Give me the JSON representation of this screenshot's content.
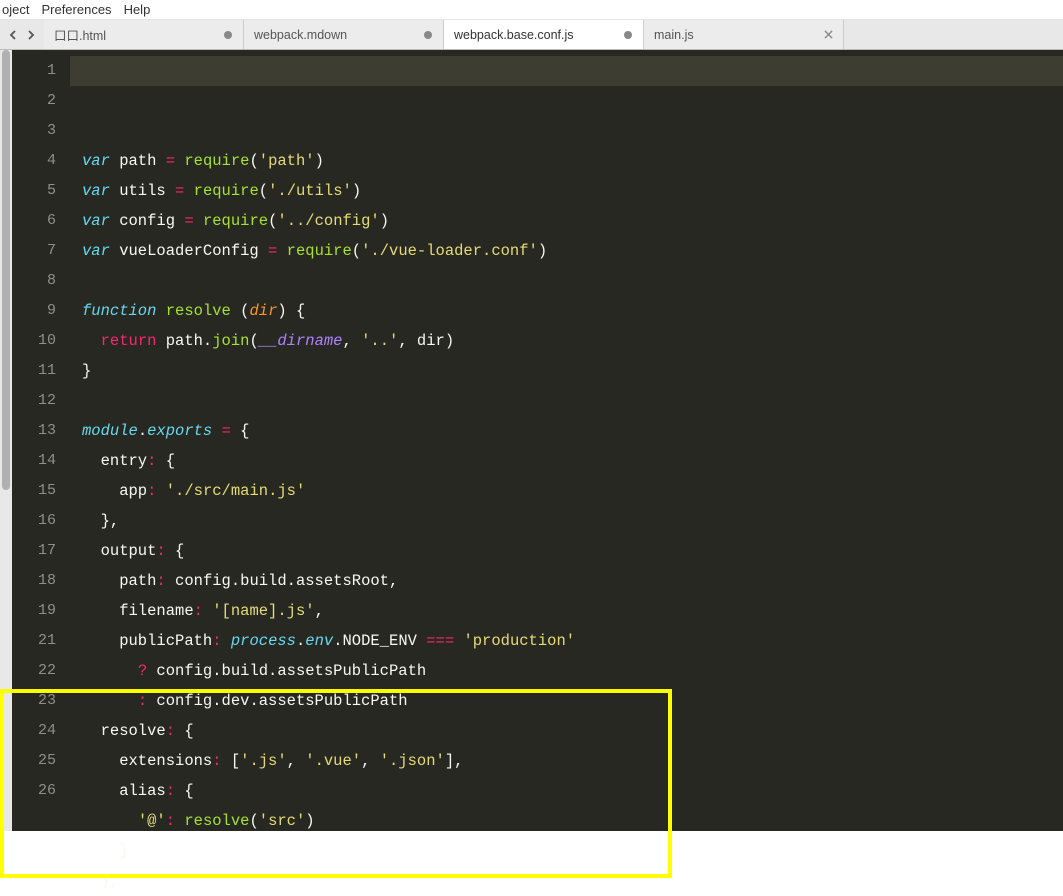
{
  "menu": {
    "project": "oject",
    "preferences": "Preferences",
    "help": "Help"
  },
  "tabs": [
    {
      "label": "口口.html",
      "dirty": true,
      "active": false
    },
    {
      "label": "webpack.mdown",
      "dirty": true,
      "active": false
    },
    {
      "label": "webpack.base.conf.js",
      "dirty": true,
      "active": true
    },
    {
      "label": "main.js",
      "dirty": false,
      "active": false
    }
  ],
  "gutter_start": 1,
  "gutter_end": 26,
  "code_tokens": [
    [
      [
        "kw-italic",
        "var"
      ],
      [
        "plain",
        " path "
      ],
      [
        "kw-red",
        "="
      ],
      [
        "plain",
        " "
      ],
      [
        "fn",
        "require"
      ],
      [
        "punct",
        "("
      ],
      [
        "str",
        "'path'"
      ],
      [
        "punct",
        ")"
      ]
    ],
    [
      [
        "kw-italic",
        "var"
      ],
      [
        "plain",
        " utils "
      ],
      [
        "kw-red",
        "="
      ],
      [
        "plain",
        " "
      ],
      [
        "fn",
        "require"
      ],
      [
        "punct",
        "("
      ],
      [
        "str",
        "'./utils'"
      ],
      [
        "punct",
        ")"
      ]
    ],
    [
      [
        "kw-italic",
        "var"
      ],
      [
        "plain",
        " config "
      ],
      [
        "kw-red",
        "="
      ],
      [
        "plain",
        " "
      ],
      [
        "fn",
        "require"
      ],
      [
        "punct",
        "("
      ],
      [
        "str",
        "'../config'"
      ],
      [
        "punct",
        ")"
      ]
    ],
    [
      [
        "kw-italic",
        "var"
      ],
      [
        "plain",
        " vueLoaderConfig "
      ],
      [
        "kw-red",
        "="
      ],
      [
        "plain",
        " "
      ],
      [
        "fn",
        "require"
      ],
      [
        "punct",
        "("
      ],
      [
        "str",
        "'./vue-loader.conf'"
      ],
      [
        "punct",
        ")"
      ]
    ],
    [],
    [
      [
        "kw-italic",
        "function"
      ],
      [
        "plain",
        " "
      ],
      [
        "fn",
        "resolve"
      ],
      [
        "plain",
        " ("
      ],
      [
        "param",
        "dir"
      ],
      [
        "punct",
        ") {"
      ]
    ],
    [
      [
        "plain",
        "  "
      ],
      [
        "kw-red",
        "return"
      ],
      [
        "plain",
        " path."
      ],
      [
        "fn",
        "join"
      ],
      [
        "punct",
        "("
      ],
      [
        "const-it",
        "__dirname"
      ],
      [
        "punct",
        ", "
      ],
      [
        "str",
        "'..'"
      ],
      [
        "punct",
        ", dir)"
      ]
    ],
    [
      [
        "punct",
        "}"
      ]
    ],
    [],
    [
      [
        "prop",
        "module"
      ],
      [
        "punct",
        "."
      ],
      [
        "prop",
        "exports"
      ],
      [
        "plain",
        " "
      ],
      [
        "kw-red",
        "="
      ],
      [
        "plain",
        " {"
      ]
    ],
    [
      [
        "plain",
        "  entry"
      ],
      [
        "kw-red",
        ":"
      ],
      [
        "plain",
        " {"
      ]
    ],
    [
      [
        "plain",
        "    app"
      ],
      [
        "kw-red",
        ":"
      ],
      [
        "plain",
        " "
      ],
      [
        "str",
        "'./src/main.js'"
      ]
    ],
    [
      [
        "plain",
        "  },"
      ]
    ],
    [
      [
        "plain",
        "  output"
      ],
      [
        "kw-red",
        ":"
      ],
      [
        "plain",
        " {"
      ]
    ],
    [
      [
        "plain",
        "    path"
      ],
      [
        "kw-red",
        ":"
      ],
      [
        "plain",
        " config.build.assetsRoot,"
      ]
    ],
    [
      [
        "plain",
        "    filename"
      ],
      [
        "kw-red",
        ":"
      ],
      [
        "plain",
        " "
      ],
      [
        "str",
        "'[name].js'"
      ],
      [
        "punct",
        ","
      ]
    ],
    [
      [
        "plain",
        "    publicPath"
      ],
      [
        "kw-red",
        ":"
      ],
      [
        "plain",
        " "
      ],
      [
        "prop",
        "process"
      ],
      [
        "punct",
        "."
      ],
      [
        "prop",
        "env"
      ],
      [
        "punct",
        ".NODE_ENV "
      ],
      [
        "kw-red",
        "==="
      ],
      [
        "plain",
        " "
      ],
      [
        "str",
        "'production'"
      ]
    ],
    [
      [
        "plain",
        "      "
      ],
      [
        "kw-red",
        "?"
      ],
      [
        "plain",
        " config.build.assetsPublicPath"
      ]
    ],
    [
      [
        "plain",
        "      "
      ],
      [
        "kw-red",
        ":"
      ],
      [
        "plain",
        " config.dev.assetsPublicPath"
      ]
    ],
    [
      [
        "plain",
        "  },"
      ]
    ],
    [
      [
        "plain",
        "  resolve"
      ],
      [
        "kw-red",
        ":"
      ],
      [
        "plain",
        " {"
      ]
    ],
    [
      [
        "plain",
        "    extensions"
      ],
      [
        "kw-red",
        ":"
      ],
      [
        "plain",
        " ["
      ],
      [
        "str",
        "'.js'"
      ],
      [
        "punct",
        ", "
      ],
      [
        "str",
        "'.vue'"
      ],
      [
        "punct",
        ", "
      ],
      [
        "str",
        "'.json'"
      ],
      [
        "punct",
        "],"
      ]
    ],
    [
      [
        "plain",
        "    alias"
      ],
      [
        "kw-red",
        ":"
      ],
      [
        "plain",
        " {"
      ]
    ],
    [
      [
        "plain",
        "      "
      ],
      [
        "str",
        "'@'"
      ],
      [
        "kw-red",
        ":"
      ],
      [
        "plain",
        " "
      ],
      [
        "fn",
        "resolve"
      ],
      [
        "punct",
        "("
      ],
      [
        "str",
        "'src'"
      ],
      [
        "punct",
        ")"
      ]
    ],
    [
      [
        "plain",
        "    }"
      ]
    ],
    [
      [
        "plain",
        "  },"
      ]
    ]
  ]
}
